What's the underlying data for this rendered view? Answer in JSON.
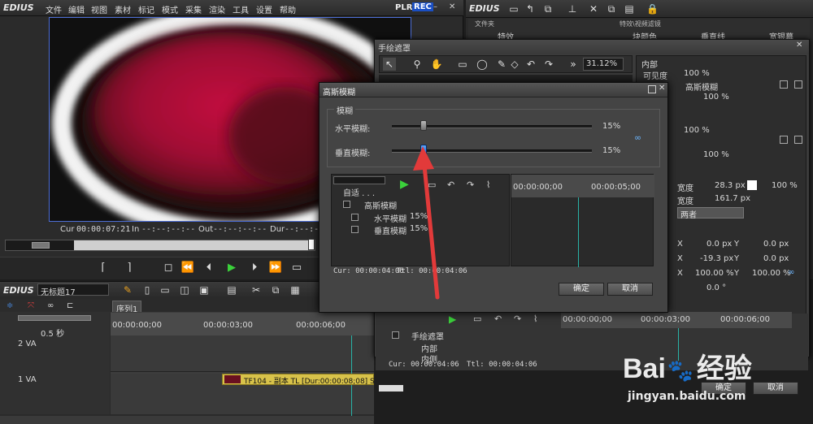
{
  "menubar": {
    "logo": "EDIUS",
    "items": [
      "文件",
      "编辑",
      "视图",
      "素材",
      "标记",
      "模式",
      "采集",
      "渲染",
      "工具",
      "设置",
      "帮助"
    ],
    "plr": "PLR",
    "rec": "REC"
  },
  "player": {
    "cur_label": "Cur",
    "cur": "00:00:07:21",
    "in_label": "In",
    "in": "--:--:--:--",
    "out_label": "Out",
    "out": "--:--:--:--",
    "dur_label": "Dur",
    "dur": "--:--:--:--"
  },
  "rightwin": {
    "logo": "EDIUS",
    "tree_header": "文件夹",
    "tree_item": "特效",
    "list_header": "特效\\视频滤镜",
    "columns": [
      "块颜色",
      "垂直线",
      "宽银幕"
    ]
  },
  "handmask": {
    "title": "手绘遮罩",
    "zoom": "31.12%",
    "props_header": "内部",
    "visibility_label": "可见度",
    "visibility_value": "100 %",
    "filter_label": "高斯模糊",
    "filter_value": "100 %",
    "section2_value1": "100 %",
    "section2_value2": "100 %",
    "width_label": "宽度",
    "width_value": "28.3 px",
    "width_pct": "100 %",
    "width2_label": "宽度",
    "width2_value": "161.7 px",
    "dropdown": "两者",
    "x1_label": "X",
    "x1_value": "0.0 px",
    "y1_label": "Y",
    "y1_value": "0.0 px",
    "x2_label": "X",
    "x2_value": "-19.3 px",
    "y2_label": "Y",
    "y2_value": "0.0 px",
    "x3_label": "X",
    "x3_value": "100.00 %",
    "y3_label": "Y",
    "y3_value": "100.00 %",
    "rot_value": "0.0 °",
    "ruler_ticks": [
      "00:00:00;00",
      "00:00:03;00",
      "00:00:06;00"
    ],
    "tree": [
      "手绘遮罩",
      "内部",
      "内侧"
    ],
    "cur": "Cur: 00:00:04:06",
    "ttl": "Ttl: 00:00:04:06",
    "ok": "确定",
    "cancel": "取消"
  },
  "gauss": {
    "title": "高斯模糊",
    "group_label": "模糊",
    "h_label": "水平模糊:",
    "h_value": "15%",
    "h_level": 0.16,
    "v_label": "垂直模糊:",
    "v_value": "15%",
    "v_level": 0.16,
    "preset": "自适 . . .",
    "tree": [
      {
        "label": "高斯模糊",
        "value": ""
      },
      {
        "label": "水平模糊",
        "value": "15%"
      },
      {
        "label": "垂直模糊",
        "value": "15%"
      }
    ],
    "ruler_ticks": [
      "00:00:00;00",
      "00:00:05;00"
    ],
    "cur": "Cur: 00:00:04:06",
    "ttl": "Ttl: 00:00:04:06",
    "ok": "确定",
    "cancel": "取消"
  },
  "timeline": {
    "logo": "EDIUS",
    "project": "无标题17",
    "sequence_tab": "序列1",
    "zoom": "0.5 秒",
    "ruler_ticks": [
      "00:00:00;00",
      "00:00:03;00",
      "00:00:06;00"
    ],
    "track2": "2 VA",
    "track1": "1 VA",
    "clip": "TF104 - 副本  TL [Dur:00:00:08;08]  S"
  },
  "watermark": {
    "brand": "Bai",
    "brand2": "经验",
    "url": "jingyan.baidu.com"
  },
  "colors": {
    "accent_blue": "#2f7de0",
    "play_green": "#3bd13b",
    "arrow_red": "#e23a3a",
    "clip_yellow": "#d8c24a"
  }
}
